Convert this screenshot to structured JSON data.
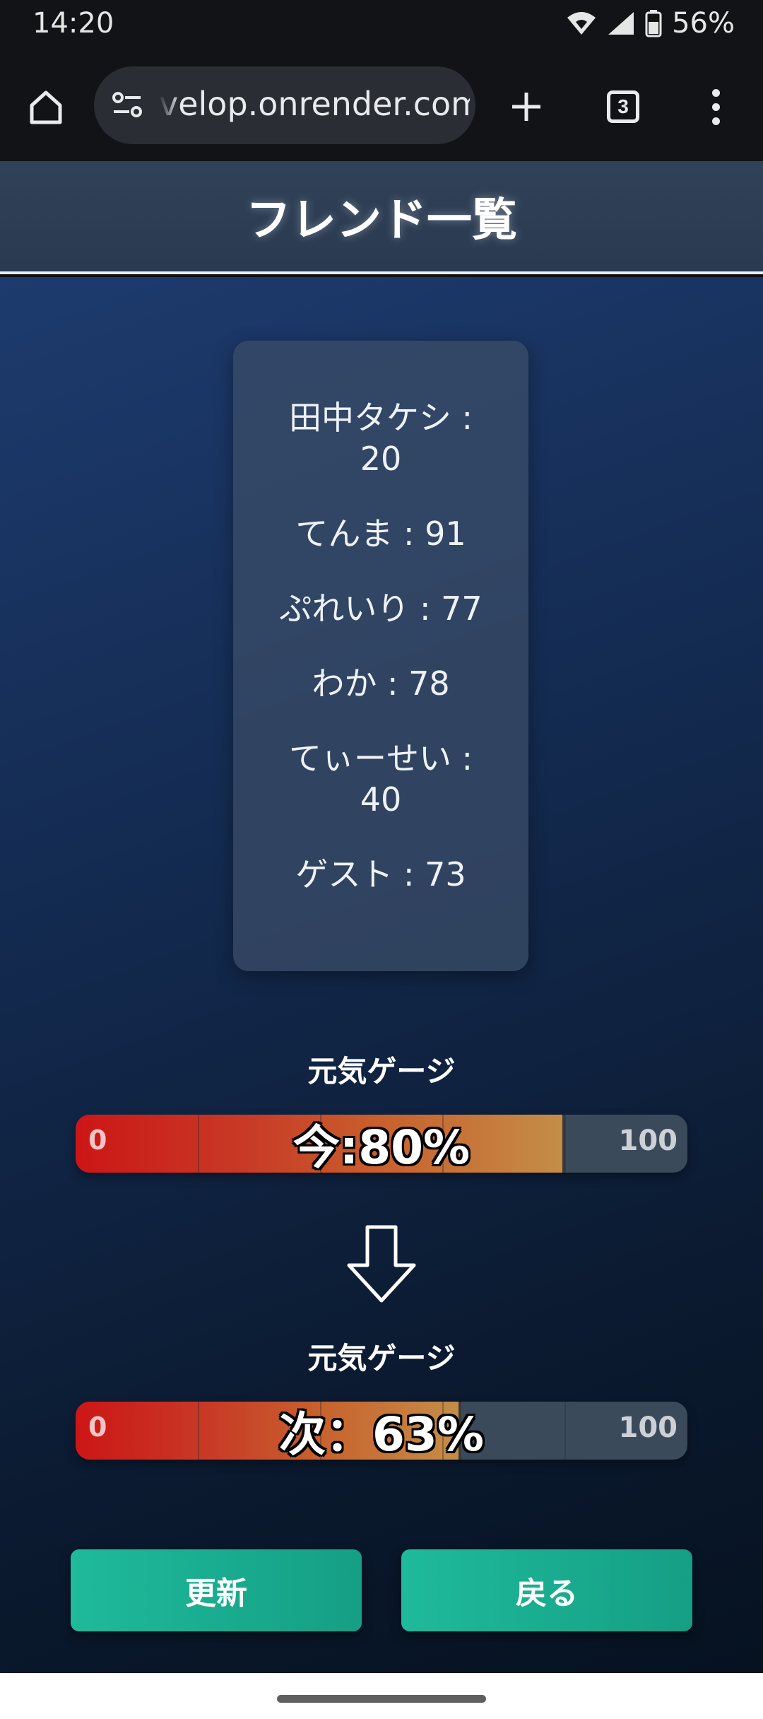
{
  "status_bar": {
    "time": "14:20",
    "battery": "56%"
  },
  "browser": {
    "url": "velop.onrender.com",
    "tab_count": "3"
  },
  "page": {
    "title": "フレンド一覧"
  },
  "friends": [
    {
      "text": "田中タケシ : 20"
    },
    {
      "text": "てんま : 91"
    },
    {
      "text": "ぷれいり : 77"
    },
    {
      "text": "わか : 78"
    },
    {
      "text": "てぃーせい : 40"
    },
    {
      "text": "ゲスト : 73"
    }
  ],
  "gauge_current": {
    "label": "元気ゲージ",
    "min": "0",
    "max": "100",
    "text": "今:80%",
    "level": 0.8
  },
  "gauge_next": {
    "label": "元気ゲージ",
    "min": "0",
    "max": "100",
    "text": "次：63%",
    "level": 0.63
  },
  "buttons": {
    "refresh": "更新",
    "back": "戻る"
  },
  "colors": {
    "accent": "#1cb394",
    "gauge_low": "#cc1616",
    "gauge_high": "#c48d48"
  }
}
